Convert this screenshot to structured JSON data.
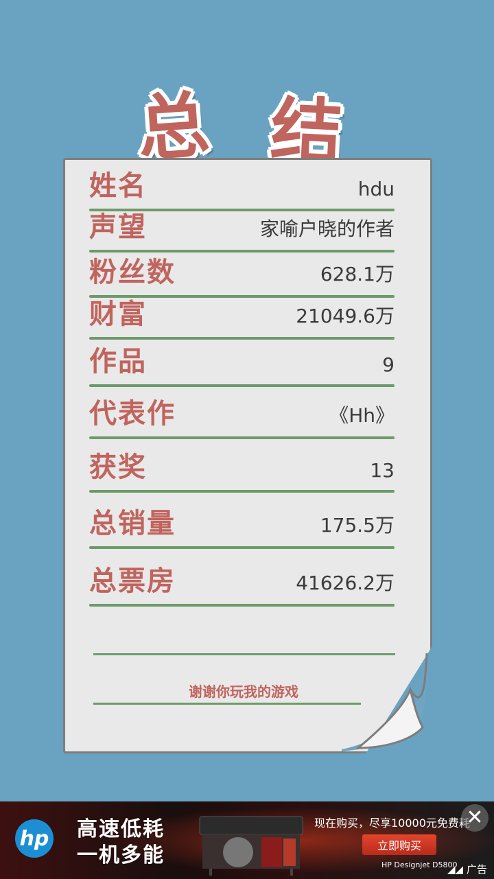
{
  "title": {
    "char1": "总",
    "char2": "结"
  },
  "rows": [
    {
      "label": "姓名",
      "value": "hdu"
    },
    {
      "label": "声望",
      "value": "家喻户晓的作者"
    },
    {
      "label": "粉丝数",
      "value": "628.1万"
    },
    {
      "label": "财富",
      "value": "21049.6万"
    },
    {
      "label": "作品",
      "value": "9"
    },
    {
      "label": "代表作",
      "value": "《Hh》"
    },
    {
      "label": "获奖",
      "value": "13"
    },
    {
      "label": "总销量",
      "value": "175.5万"
    },
    {
      "label": "总票房",
      "value": "41626.2万"
    }
  ],
  "thanks": "谢谢你玩我的游戏",
  "ad": {
    "logo": "hp",
    "headline_line1": "高速低耗",
    "headline_line2": "一机多能",
    "promo": "现在购买，尽享10000元免费耗",
    "cta": "立即购买",
    "model": "HP Designjet D5800",
    "close": "✕",
    "tag": "广告",
    "tag_icon": "ad-brand-icon"
  },
  "colors": {
    "background": "#6ea5c2",
    "label": "#c0645e",
    "rule": "#6d9a6a",
    "paper": "#e9e9e9"
  }
}
